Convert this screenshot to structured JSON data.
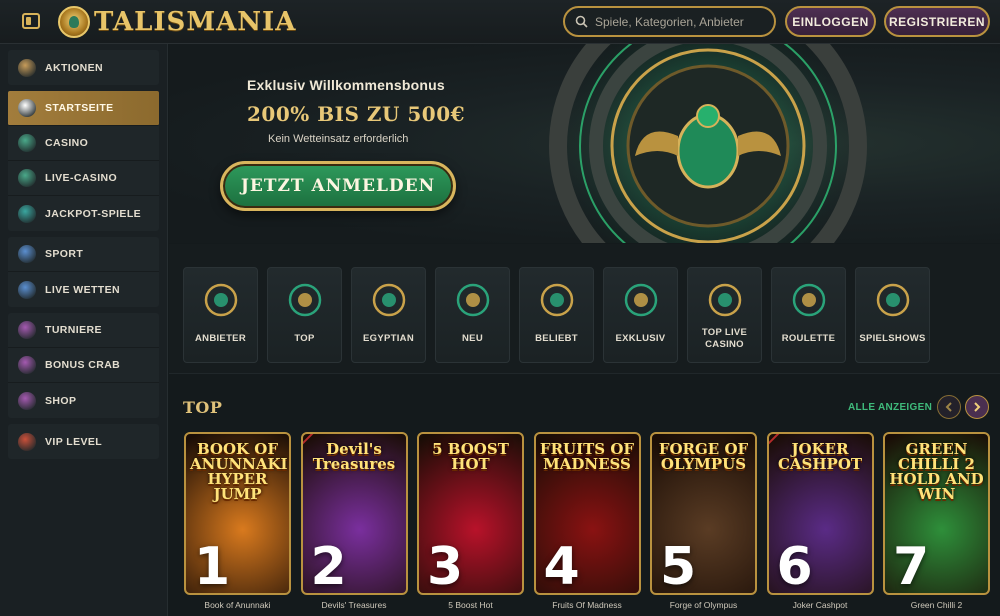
{
  "header": {
    "logo_text": "TALISMANIA",
    "search_placeholder": "Spiele, Kategorien, Anbieter",
    "login_label": "EINLOGGEN",
    "register_label": "REGISTRIEREN"
  },
  "sidebar": {
    "items": [
      {
        "label": "AKTIONEN",
        "icon": "calendar-icon",
        "color": "#c79c5a"
      },
      {
        "label": "STARTSEITE",
        "icon": "pyramid-icon",
        "color": "#ffffff"
      },
      {
        "label": "CASINO",
        "icon": "coin-icon",
        "color": "#4aa98a"
      },
      {
        "label": "LIVE-CASINO",
        "icon": "pyramid-live-icon",
        "color": "#4aa98a"
      },
      {
        "label": "JACKPOT-SPIELE",
        "icon": "scarab-icon",
        "color": "#3aa7a0"
      },
      {
        "label": "SPORT",
        "icon": "football-icon",
        "color": "#5b8fd0"
      },
      {
        "label": "LIVE WETTEN",
        "icon": "live-play-icon",
        "color": "#5b8fd0"
      },
      {
        "label": "TURNIERE",
        "icon": "trophy-icon",
        "color": "#a45ab0"
      },
      {
        "label": "BONUS CRAB",
        "icon": "crab-icon",
        "color": "#a45ab0"
      },
      {
        "label": "SHOP",
        "icon": "temple-icon",
        "color": "#a45ab0"
      },
      {
        "label": "VIP LEVEL",
        "icon": "diamond-icon",
        "color": "#c9503a"
      }
    ]
  },
  "hero": {
    "eyebrow": "Exklusiv Willkommensbonus",
    "title": "200% BIS ZU 500€",
    "subtitle": "Kein Wetteinsatz erforderlich",
    "cta_label": "JETZT ANMELDEN"
  },
  "categories": [
    {
      "label": "ANBIETER",
      "icon": "scroll-icon"
    },
    {
      "label": "TOP",
      "icon": "scarab-icon"
    },
    {
      "label": "EGYPTIAN",
      "icon": "eye-of-horus-icon"
    },
    {
      "label": "NEU",
      "icon": "sun-disc-icon"
    },
    {
      "label": "BELIEBT",
      "icon": "pharaoh-crown-icon"
    },
    {
      "label": "EXKLUSIV",
      "icon": "pharaoh-mask-icon"
    },
    {
      "label": "TOP LIVE CASINO",
      "icon": "nefertiti-icon"
    },
    {
      "label": "ROULETTE",
      "icon": "roulette-icon"
    },
    {
      "label": "SPIELSHOWS",
      "icon": "wheel-icon"
    }
  ],
  "top_section": {
    "title": "TOP",
    "show_all_label": "ALLE ANZEIGEN",
    "games": [
      {
        "rank": "1",
        "name": "Book of Anunnaki",
        "art_title": "BOOK OF ANUNNAKI HYPER JUMP",
        "bg": "#d97a1e",
        "exclusive": false
      },
      {
        "rank": "2",
        "name": "Devils' Treasures",
        "art_title": "Devil's Treasures",
        "bg": "#7a2f9e",
        "exclusive": true
      },
      {
        "rank": "3",
        "name": "5 Boost Hot",
        "art_title": "5 BOOST HOT",
        "bg": "#b8122a",
        "exclusive": false
      },
      {
        "rank": "4",
        "name": "Fruits Of Madness",
        "art_title": "FRUITS OF MADNESS",
        "bg": "#8a1212",
        "exclusive": false
      },
      {
        "rank": "5",
        "name": "Forge of Olympus",
        "art_title": "FORGE OF OLYMPUS",
        "bg": "#5a3c24",
        "exclusive": false
      },
      {
        "rank": "6",
        "name": "Joker Cashpot",
        "art_title": "JOKER CASHPOT",
        "bg": "#5a2b86",
        "exclusive": true
      },
      {
        "rank": "7",
        "name": "Green Chilli 2",
        "art_title": "GREEN CHILLI 2 HOLD AND WIN",
        "bg": "#2e8f3a",
        "exclusive": false
      }
    ]
  }
}
